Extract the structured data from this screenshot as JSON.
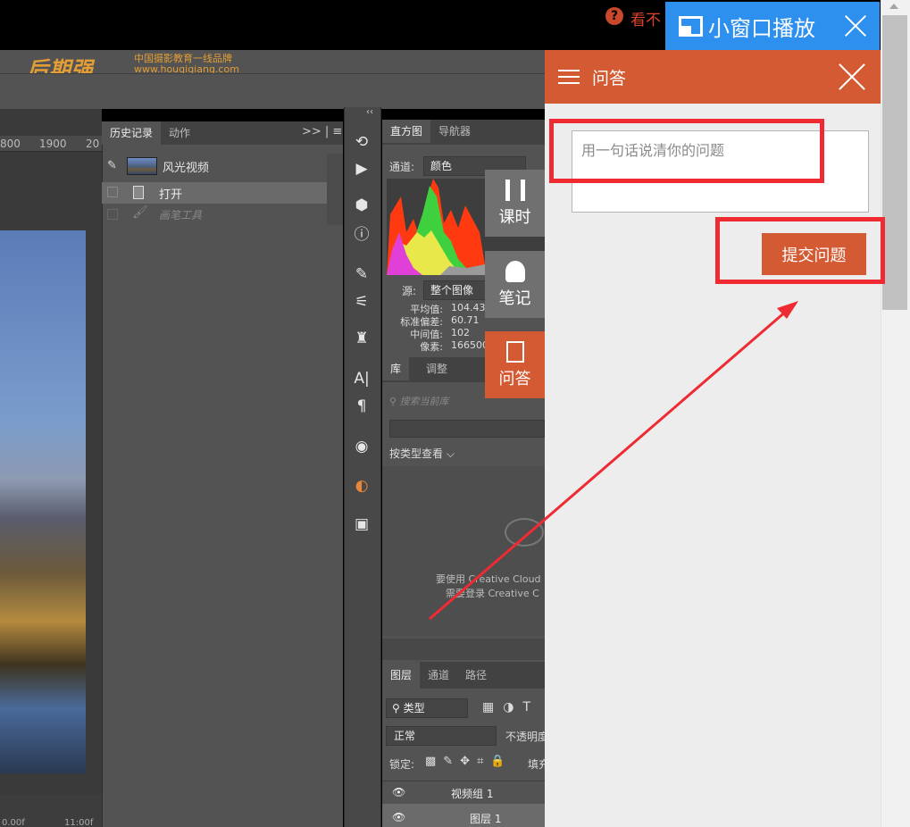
{
  "topbar": {
    "help_hint": "看不",
    "mini_player_label": "小窗口播放"
  },
  "logo": {
    "brand": "后期强",
    "slogan": "中国摄影教育一线品牌",
    "url": "www.houqiqiang.com"
  },
  "ruler": {
    "marks": [
      "800",
      "1900",
      "20"
    ]
  },
  "canvas": {
    "bottom_left": "0.00f",
    "bottom_right": "11:00f"
  },
  "history_panel": {
    "tabs": [
      "历史记录",
      "动作"
    ],
    "menu": ">> | ≡",
    "snapshot": "风光视频",
    "items": [
      {
        "label": "打开"
      },
      {
        "label": "画笔工具"
      }
    ]
  },
  "histogram_panel": {
    "tabs": [
      "直方图",
      "导航器"
    ],
    "channel_label": "通道:",
    "channel_value": "颜色",
    "source_label": "源:",
    "source_value": "整个图像",
    "stats": [
      {
        "label": "平均值:",
        "value": "104.43"
      },
      {
        "label": "标准偏差:",
        "value": "60.71"
      },
      {
        "label": "中间值:",
        "value": "102"
      },
      {
        "label": "像素:",
        "value": "166500"
      }
    ]
  },
  "library_panel": {
    "tabs": [
      "库",
      "调整"
    ],
    "search_placeholder": "搜索当前库",
    "view_by": "按类型查看",
    "cc_line1": "要使用 Creative Cloud",
    "cc_line2": "需要登录 Creative C"
  },
  "layers_panel": {
    "tabs": [
      "图层",
      "通道",
      "路径"
    ],
    "filter": "类型",
    "blend_mode": "正常",
    "opacity_label": "不透明度",
    "lock_label": "锁定:",
    "fill_label": "填充",
    "layers": [
      {
        "name": "视频组 1"
      },
      {
        "name": "图层 1"
      }
    ]
  },
  "side_buttons": {
    "lesson": "课时",
    "notes": "笔记",
    "qa": "问答"
  },
  "qa_panel": {
    "title": "问答",
    "input_placeholder": "用一句话说清你的问题",
    "input_value": "",
    "submit_label": "提交问题"
  },
  "colors": {
    "accent": "#d35a32",
    "mini_player": "#2d8fee",
    "annotation": "#ee2b33"
  }
}
